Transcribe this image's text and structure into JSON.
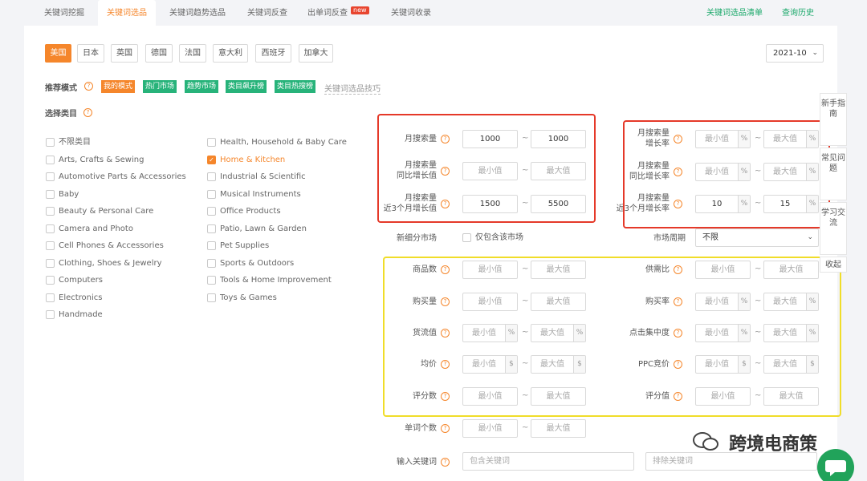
{
  "tabs": [
    {
      "label": "关键词挖掘"
    },
    {
      "label": "关键词选品",
      "active": true
    },
    {
      "label": "关键词趋势选品"
    },
    {
      "label": "关键词反查"
    },
    {
      "label": "出单词反查",
      "badge": "new"
    },
    {
      "label": "关键词收录"
    }
  ],
  "top_links": {
    "selection_list": "关键词选品清单",
    "history": "查询历史"
  },
  "countries": [
    "美国",
    "日本",
    "英国",
    "德国",
    "法国",
    "意大利",
    "西班牙",
    "加拿大"
  ],
  "active_country": "美国",
  "date_select": "2021-10",
  "recommend": {
    "label": "推荐模式",
    "tags": [
      {
        "label": "我的模式",
        "color": "#f5862b"
      },
      {
        "label": "热门市场",
        "color": "#27b37a"
      },
      {
        "label": "趋势市场",
        "color": "#27b37a"
      },
      {
        "label": "类目飙升榜",
        "color": "#27b37a"
      },
      {
        "label": "类目热搜榜",
        "color": "#27b37a"
      }
    ],
    "tips": "关键词选品技巧"
  },
  "category": {
    "label": "选择类目",
    "left": [
      "不限类目",
      "Arts, Crafts & Sewing",
      "Automotive Parts & Accessories",
      "Baby",
      "Beauty & Personal Care",
      "Camera and Photo",
      "Cell Phones & Accessories",
      "Clothing, Shoes & Jewelry",
      "Computers",
      "Electronics",
      "Handmade"
    ],
    "right": [
      "Health, Household & Baby Care",
      "Home & Kitchen",
      "Industrial & Scientific",
      "Musical Instruments",
      "Office Products",
      "Patio, Lawn & Garden",
      "Pet Supplies",
      "Sports & Outdoors",
      "Tools & Home Improvement",
      "Toys & Games"
    ],
    "checked": "Home & Kitchen"
  },
  "placeholders": {
    "min": "最小值",
    "max": "最大值"
  },
  "filters": {
    "monthly_search": {
      "label": "月搜索量",
      "min": "1000",
      "max": "1000"
    },
    "yoy_growth": {
      "label1": "月搜索量",
      "label2": "同比增长值"
    },
    "three_month_growth": {
      "label1": "月搜索量",
      "label2": "近3个月增长值",
      "min": "1500",
      "max": "5500"
    },
    "monthly_growth_rate": {
      "label1": "月搜索量",
      "label2": "增长率"
    },
    "yoy_growth_rate": {
      "label1": "月搜索量",
      "label2": "同比增长率"
    },
    "three_month_growth_rate": {
      "label1": "月搜索量",
      "label2": "近3个月增长率",
      "min": "10",
      "max": "15"
    },
    "new_segment": {
      "label": "新细分市场",
      "option": "仅包含该市场"
    },
    "market_cycle": {
      "label": "市场周期",
      "value": "不限"
    },
    "product_count": {
      "label": "商品数"
    },
    "supply_demand": {
      "label": "供需比"
    },
    "purchase_volume": {
      "label": "购买量"
    },
    "purchase_rate": {
      "label": "购买率"
    },
    "gmv": {
      "label": "货流值"
    },
    "click_concentration": {
      "label": "点击集中度"
    },
    "avg_price": {
      "label": "均价"
    },
    "ppc_bid": {
      "label": "PPC竞价"
    },
    "review_count": {
      "label": "评分数"
    },
    "rating": {
      "label": "评分值"
    },
    "word_count": {
      "label": "单词个数"
    },
    "keyword": {
      "label": "输入关键词",
      "include": "包含关键词",
      "exclude": "排除关键词"
    }
  },
  "units": {
    "percent": "%",
    "dollar": "$"
  },
  "side_tabs": [
    "新手指南",
    "常见问题",
    "学习交流"
  ],
  "collapse": "收起",
  "watermark": "跨境电商策",
  "colors": {
    "accent": "#f5862b",
    "green": "#27b37a",
    "red_box": "#e53929",
    "yellow_box": "#f0dd29"
  }
}
